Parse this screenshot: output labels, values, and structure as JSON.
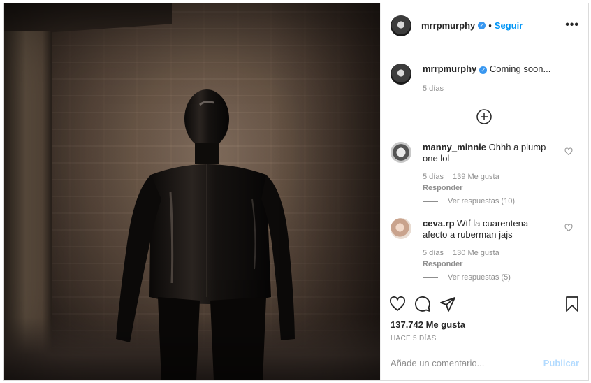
{
  "post": {
    "username": "mrrpmurphy",
    "follow_label": "Seguir",
    "dot": "•",
    "more_label": "•••",
    "verified_mark": "✓"
  },
  "caption": {
    "username": "mrrpmurphy",
    "text": "Coming soon...",
    "time": "5 días"
  },
  "comments": [
    {
      "username": "manny_minnie",
      "text": "Ohhh a plump one lol",
      "time": "5 días",
      "likes": "139 Me gusta",
      "reply_label": "Responder",
      "view_replies": "Ver respuestas (10)"
    },
    {
      "username": "ceva.rp",
      "text": "Wtf la cuarentena afecto a ruberman jajs",
      "time": "5 días",
      "likes": "130 Me gusta",
      "reply_label": "Responder",
      "view_replies": "Ver respuestas (5)"
    }
  ],
  "actions": {
    "likes_count": "137.742 Me gusta",
    "posted_ago": "HACE 5 DÍAS"
  },
  "comment_box": {
    "placeholder": "Añade un comentario...",
    "publish_label": "Publicar"
  },
  "icons": {
    "like": "heart-icon",
    "comment": "comment-icon",
    "share": "share-icon",
    "save": "bookmark-icon",
    "load_more": "plus-circle-icon",
    "verified": "verified-badge-icon"
  },
  "colors": {
    "link_blue": "#0095f6",
    "verified_blue": "#3897f0",
    "publish_disabled": "#b3dbff",
    "secondary_text": "#8e8e8e",
    "border": "#efefef"
  }
}
